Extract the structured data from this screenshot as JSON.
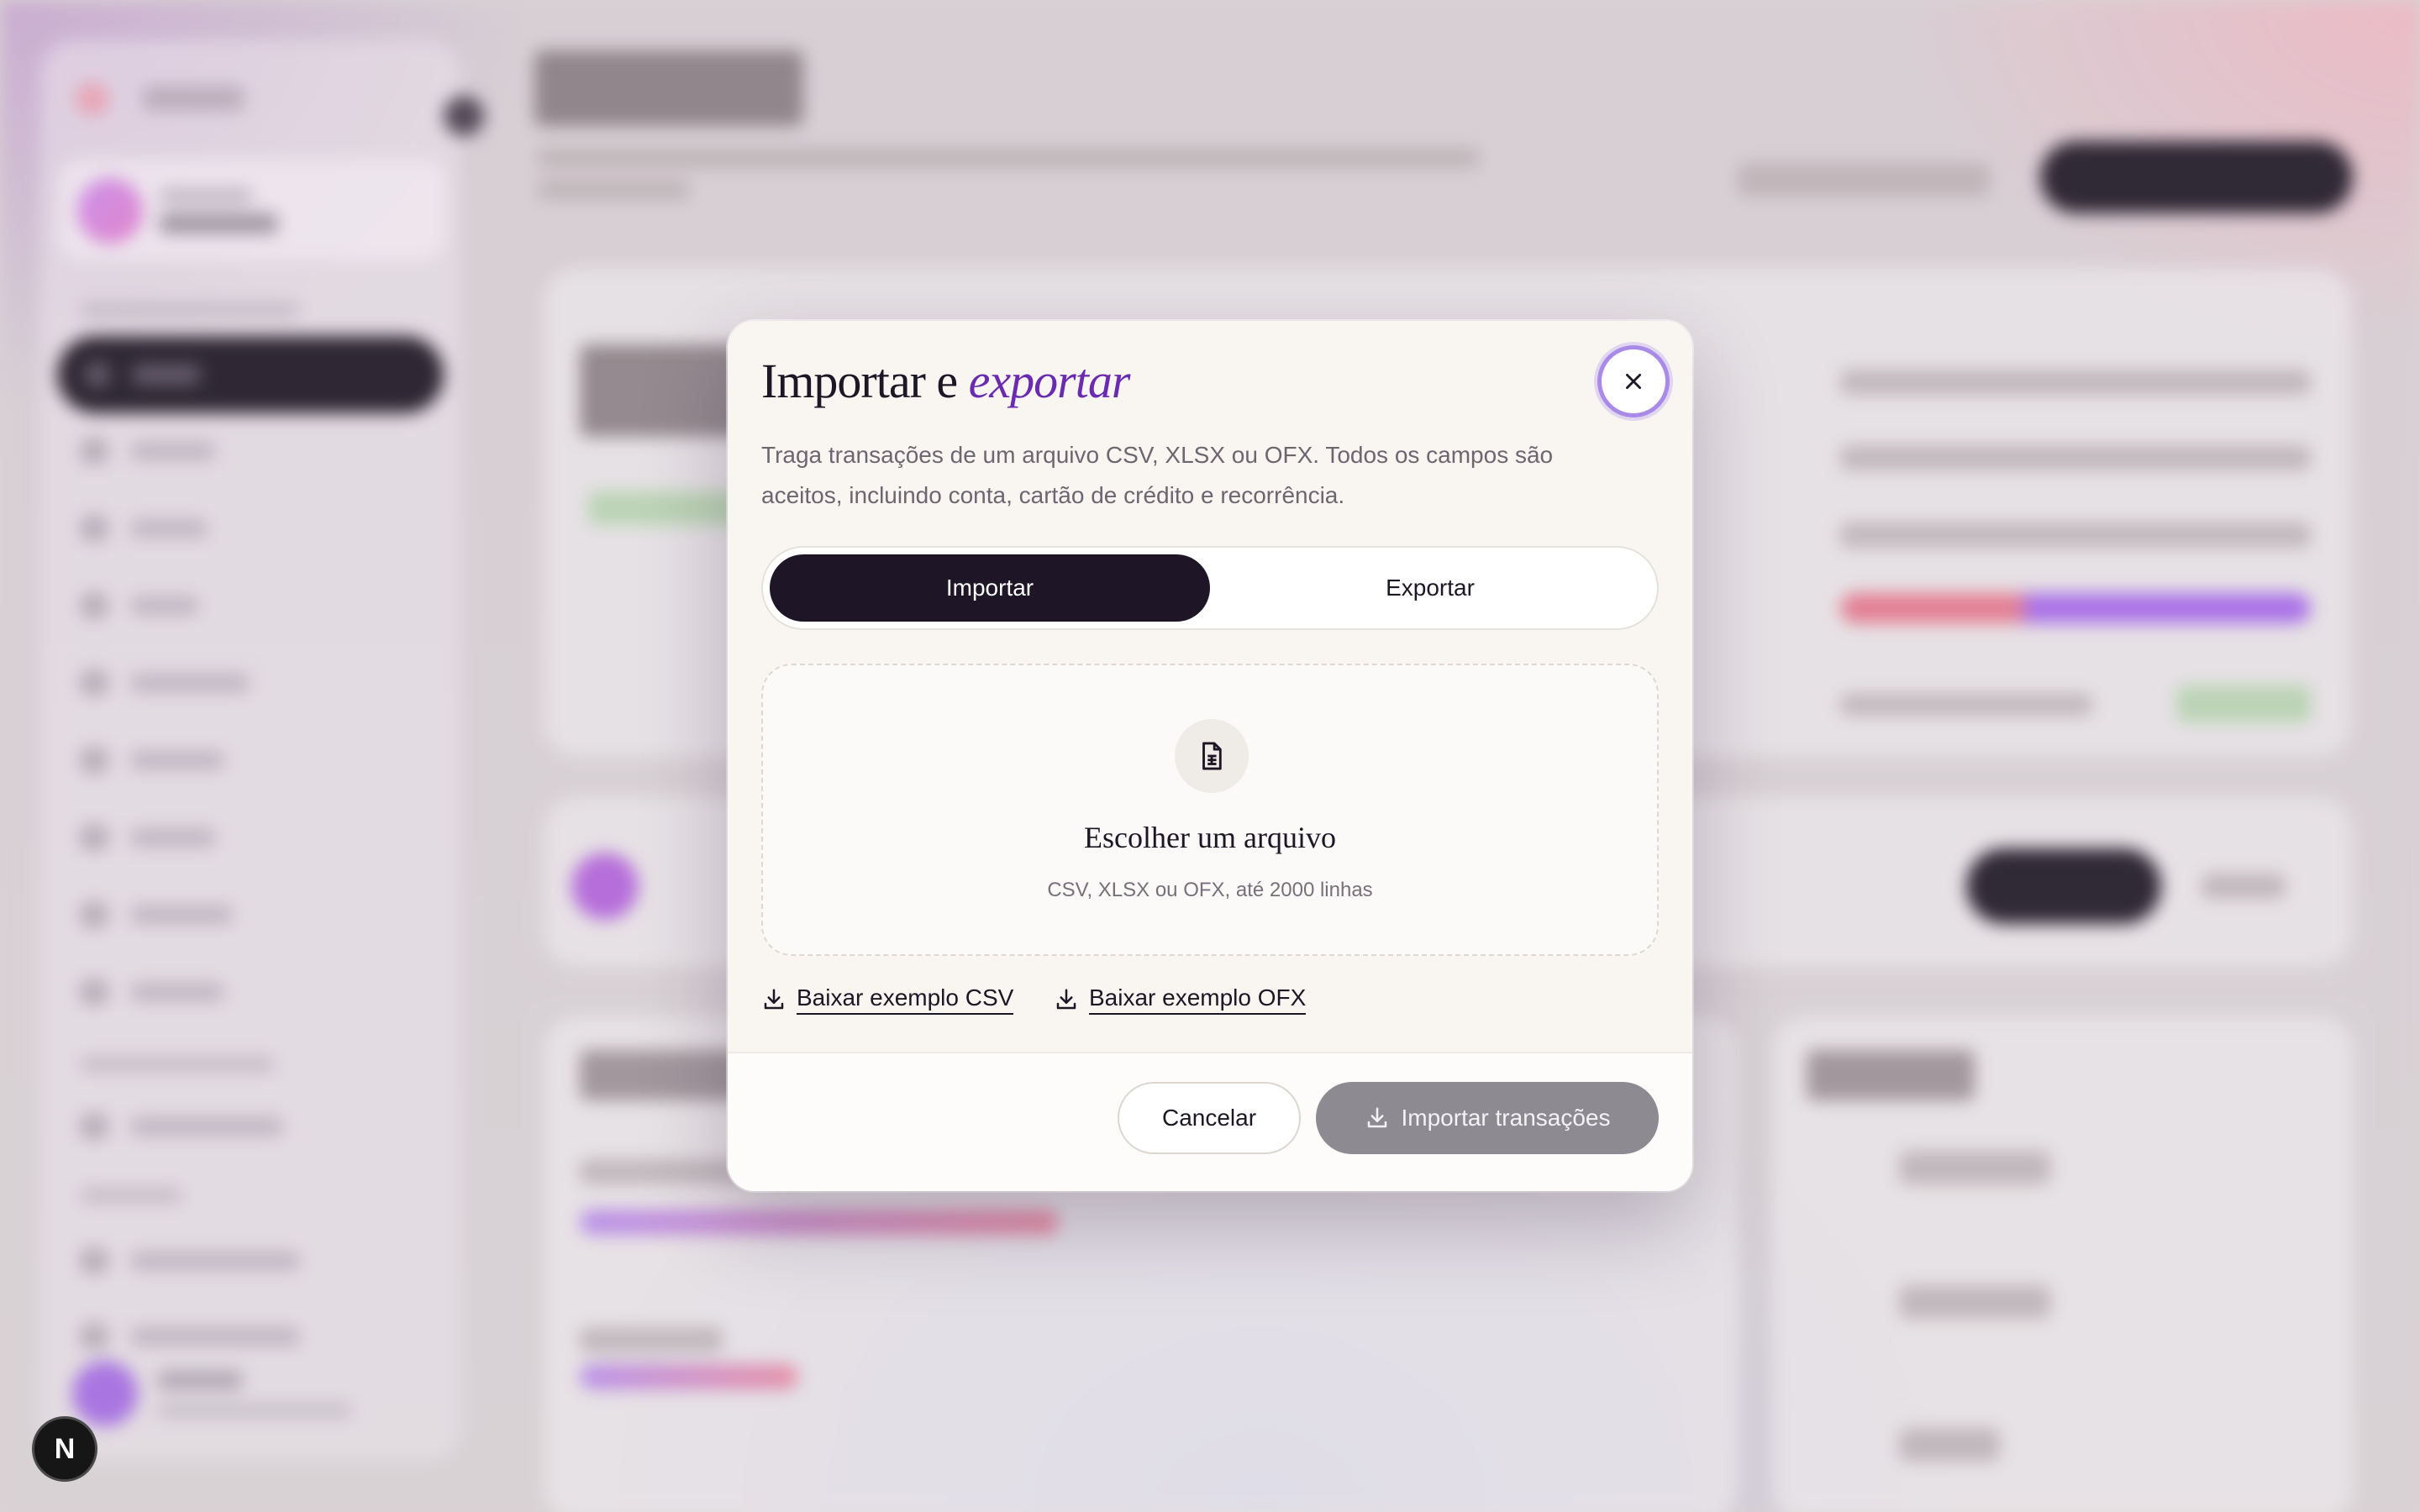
{
  "modal": {
    "title_plain": "Importar e",
    "title_accent": "exportar",
    "description": "Traga transações de um arquivo CSV, XLSX ou OFX. Todos os campos são aceitos, incluindo conta, cartão de crédito e recorrência.",
    "tabs": [
      {
        "label": "Importar",
        "active": true
      },
      {
        "label": "Exportar",
        "active": false
      }
    ],
    "dropzone": {
      "icon": "file-spreadsheet-icon",
      "title": "Escolher um arquivo",
      "subtitle": "CSV, XLSX ou OFX, até 2000 linhas"
    },
    "downloads": [
      {
        "label": "Baixar exemplo CSV",
        "icon": "download-icon"
      },
      {
        "label": "Baixar exemplo OFX",
        "icon": "download-icon"
      }
    ],
    "footer": {
      "cancel_label": "Cancelar",
      "import_label": "Importar transações"
    },
    "close_icon": "close-icon"
  },
  "dev_badge": {
    "label": "N"
  },
  "colors": {
    "accent": "#6a2bb0",
    "primary_dark": "#1e1626",
    "disabled_button": "#8e8a92",
    "close_ring": "#a98ae8"
  }
}
